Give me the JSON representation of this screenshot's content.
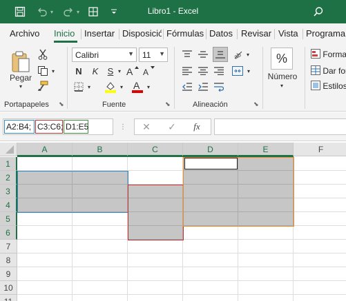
{
  "window": {
    "title": "Libro1 - Excel"
  },
  "tabs": [
    {
      "label": "Archivo",
      "active": false
    },
    {
      "label": "Inicio",
      "active": true
    },
    {
      "label": "Insertar",
      "active": false
    },
    {
      "label": "Disposición",
      "active": false
    },
    {
      "label": "Fórmulas",
      "active": false
    },
    {
      "label": "Datos",
      "active": false
    },
    {
      "label": "Revisar",
      "active": false
    },
    {
      "label": "Vista",
      "active": false
    },
    {
      "label": "Programa",
      "active": false
    }
  ],
  "ribbon": {
    "clipboard": {
      "paste_label": "Pegar",
      "group_label": "Portapapeles"
    },
    "font": {
      "name": "Calibri",
      "size": "11",
      "bold": "N",
      "italic": "K",
      "underline": "S",
      "font_color_glyph": "A",
      "group_label": "Fuente",
      "highlight_color": "#ffff00",
      "font_color": "#e00000"
    },
    "alignment": {
      "group_label": "Alineación"
    },
    "number": {
      "symbol": "%",
      "label": "Número"
    },
    "styles": {
      "item1": "Formato",
      "item2": "Dar formato",
      "item3": "Estilos"
    }
  },
  "formula_bar": {
    "name_box_segments": [
      {
        "text": "A2:B4;",
        "color": "#2e8bc6"
      },
      {
        "text": "C3:C6;",
        "color": "#c43030"
      },
      {
        "text": "D1:E5",
        "color": "#3a8d3a"
      }
    ],
    "fx": "fx",
    "content": ""
  },
  "grid": {
    "columns": [
      "A",
      "B",
      "C",
      "D",
      "E",
      "F"
    ],
    "rows": [
      "1",
      "2",
      "3",
      "4",
      "5",
      "6",
      "7",
      "8",
      "9",
      "10",
      "11"
    ],
    "selected_columns": [
      "A",
      "B",
      "C",
      "D",
      "E"
    ],
    "selected_rows": [
      "1",
      "2",
      "3",
      "4",
      "5",
      "6"
    ],
    "ranges": [
      {
        "ref": "A2:B4",
        "color": "#2e8bc6"
      },
      {
        "ref": "C3:C6",
        "color": "#c43030"
      },
      {
        "ref": "D1:E5",
        "color": "#f08a24"
      }
    ],
    "active_cell": "D1"
  }
}
